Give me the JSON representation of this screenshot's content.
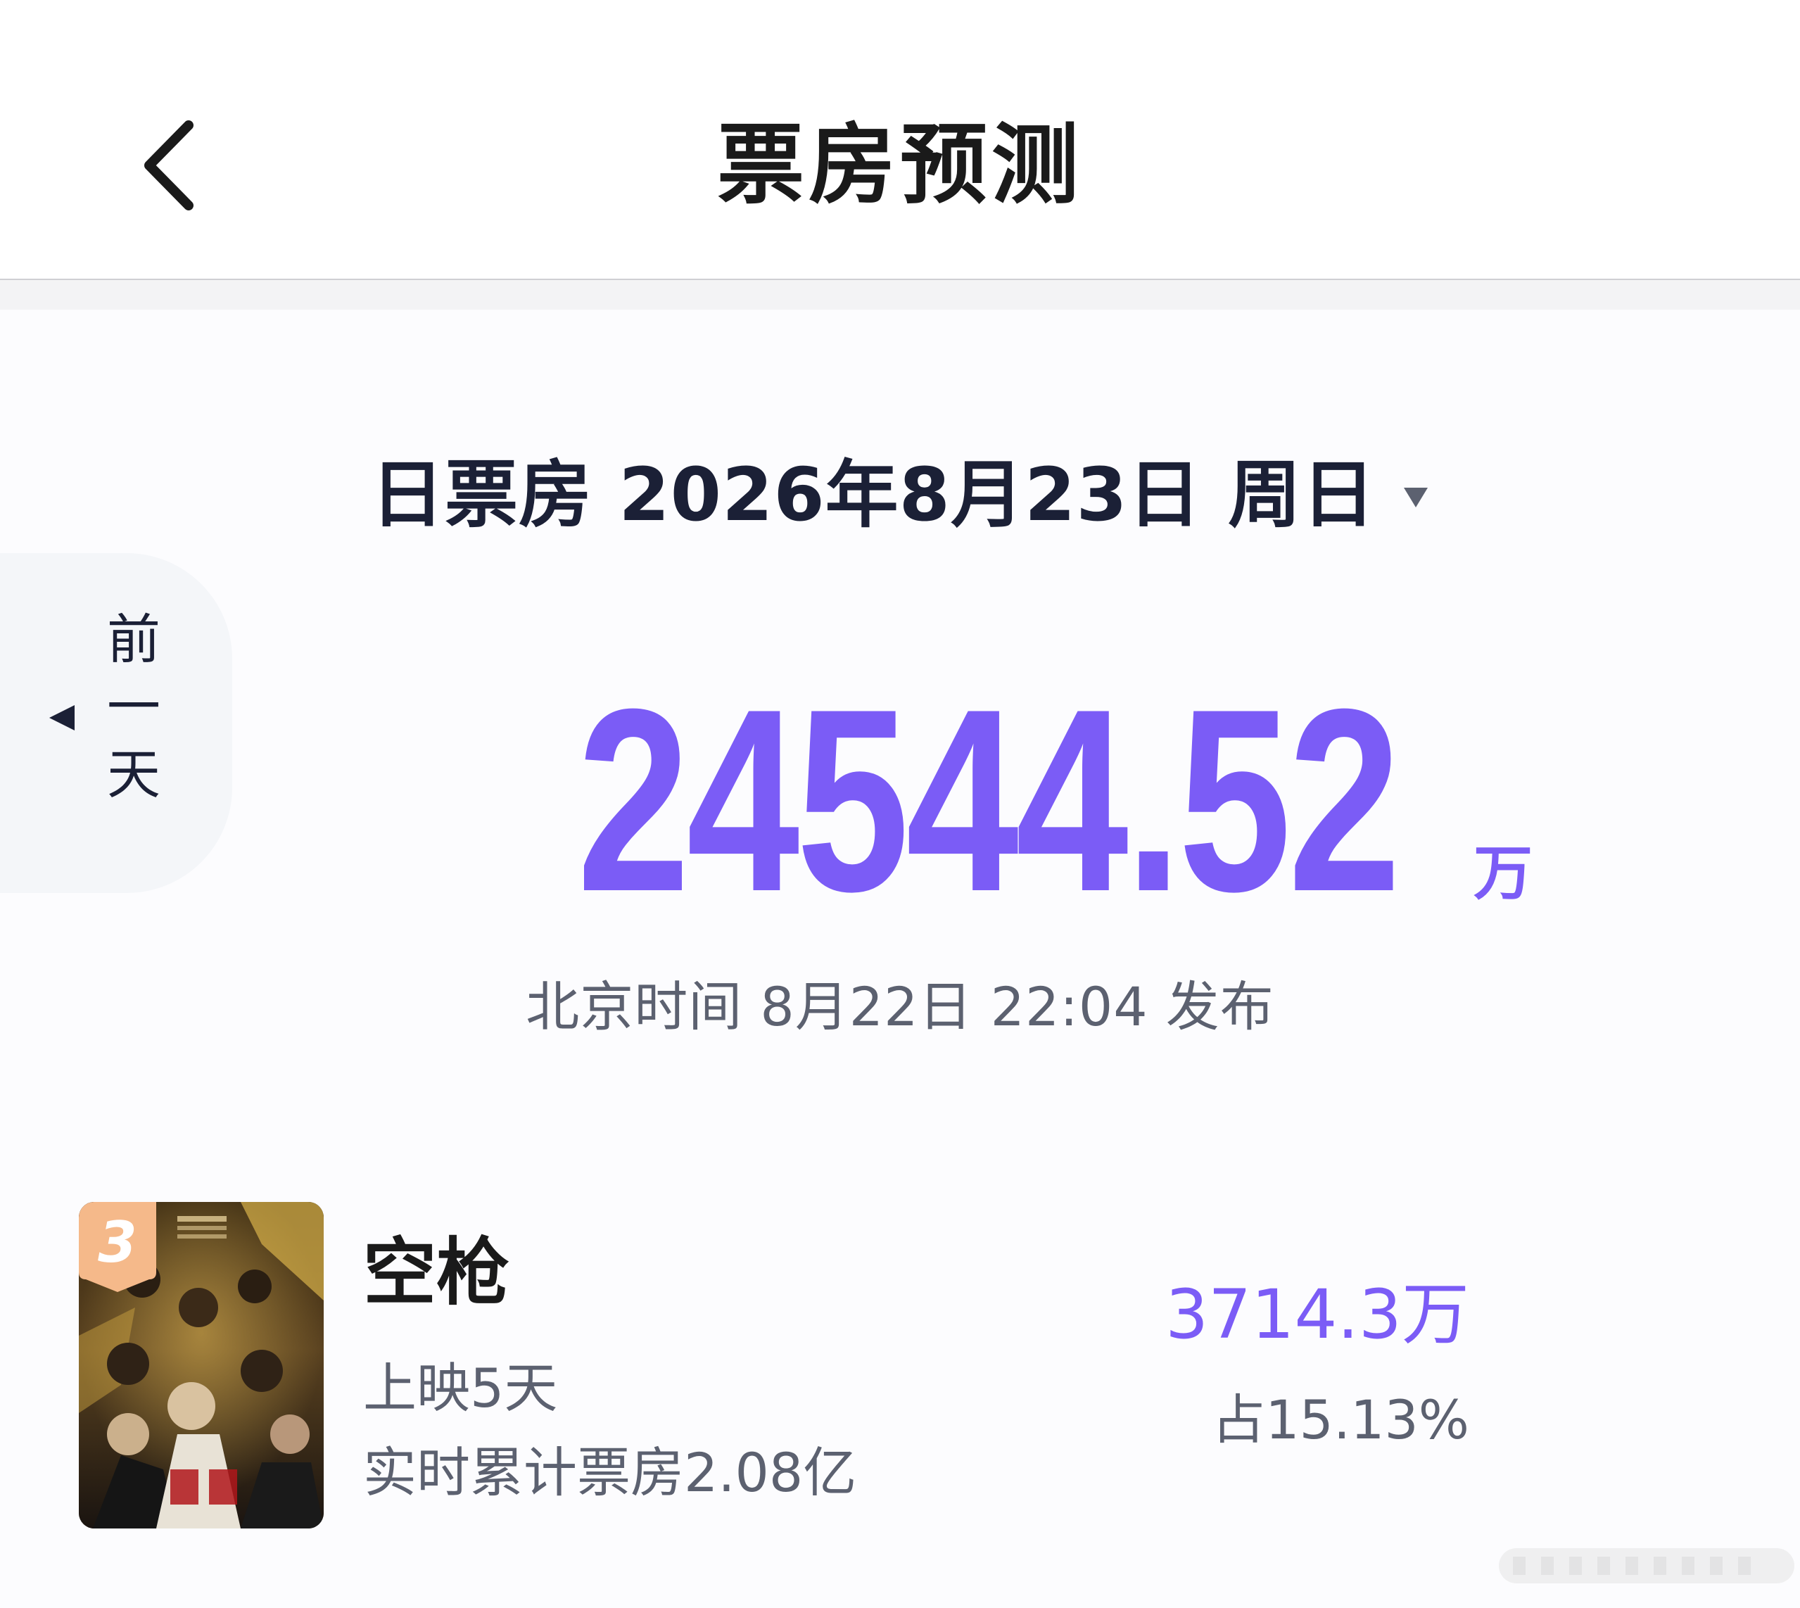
{
  "header": {
    "title": "票房预测",
    "back_icon": "chevron-left-icon"
  },
  "date_selector": {
    "label": "日票房 2026年8月23日 周日",
    "caret_icon": "caret-down-icon"
  },
  "prev_day": {
    "label": "前一天",
    "arrow_icon": "triangle-left-icon"
  },
  "total": {
    "value": "24544.52",
    "unit": "万"
  },
  "publish_time": "北京时间 8月22日 22:04 发布",
  "movie": {
    "rank": "3",
    "title": "空枪",
    "days_showing": "上映5天",
    "cumulative": "实时累计票房2.08亿",
    "daily_boxoffice": "3714.3万",
    "share": "占15.13%"
  },
  "colors": {
    "accent": "#7b5cf6",
    "text_primary": "#1b2036",
    "text_secondary": "#5c6170",
    "badge": "#f5b98a"
  }
}
